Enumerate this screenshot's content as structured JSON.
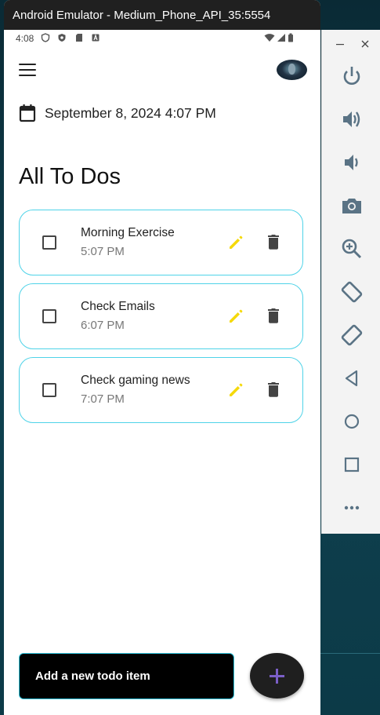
{
  "window": {
    "title": "Android Emulator - Medium_Phone_API_35:5554"
  },
  "status_bar": {
    "time": "4:08"
  },
  "header": {
    "date_text": "September 8, 2024 4:07 PM"
  },
  "list": {
    "heading": "All To Dos",
    "items": [
      {
        "title": "Morning Exercise",
        "time": "5:07 PM",
        "checked": false
      },
      {
        "title": "Check Emails",
        "time": "6:07 PM",
        "checked": false
      },
      {
        "title": "Check gaming news",
        "time": "7:07 PM",
        "checked": false
      }
    ]
  },
  "composer": {
    "placeholder": "Add a new todo item"
  },
  "colors": {
    "card_border": "#4fd3e8",
    "edit_icon": "#f5d90a",
    "fab_plus": "#7b5fc7",
    "input_border": "#2fc4de"
  },
  "toolbar": {
    "icons": [
      "power-icon",
      "volume-up-icon",
      "volume-down-icon",
      "camera-icon",
      "zoom-icon",
      "rotate-left-icon",
      "rotate-right-icon",
      "back-icon",
      "home-icon",
      "overview-icon",
      "more-icon"
    ]
  }
}
